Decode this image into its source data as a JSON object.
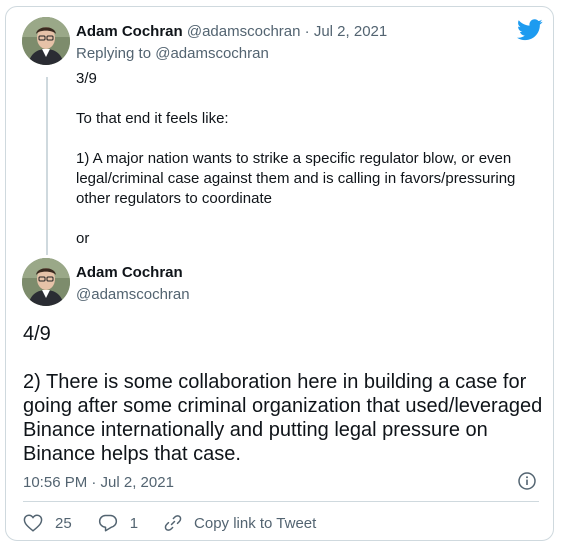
{
  "tweet1": {
    "author_name": "Adam Cochran",
    "author_handle": "@adamscochran",
    "separator": "·",
    "date": "Jul 2, 2021",
    "replying_prefix": "Replying to ",
    "replying_to": "@adamscochran",
    "paragraphs": [
      "3/9",
      "To that end it feels like:",
      "1) A major nation wants to strike a specific regulator blow, or even legal/criminal case against them and is calling in favors/pressuring other regulators to coordinate",
      "or"
    ]
  },
  "tweet2": {
    "author_name": "Adam Cochran",
    "author_handle": "@adamscochran",
    "paragraphs": [
      "4/9",
      "2) There is some collaboration here in building a case for going after some criminal organization that used/leveraged Binance internationally and putting legal pressure on Binance helps that case."
    ],
    "timestamp": "10:56 PM · Jul 2, 2021"
  },
  "actions": {
    "likes": "25",
    "replies": "1",
    "copy_link_label": "Copy link to Tweet"
  },
  "icons": {
    "brand": "twitter-bird-icon",
    "info": "info-icon",
    "like": "heart-icon",
    "reply": "reply-bubble-icon",
    "link": "link-icon"
  },
  "colors": {
    "brand": "#1d9bf0",
    "text": "#0f1419",
    "muted": "#536471",
    "border": "#cfd9de"
  }
}
